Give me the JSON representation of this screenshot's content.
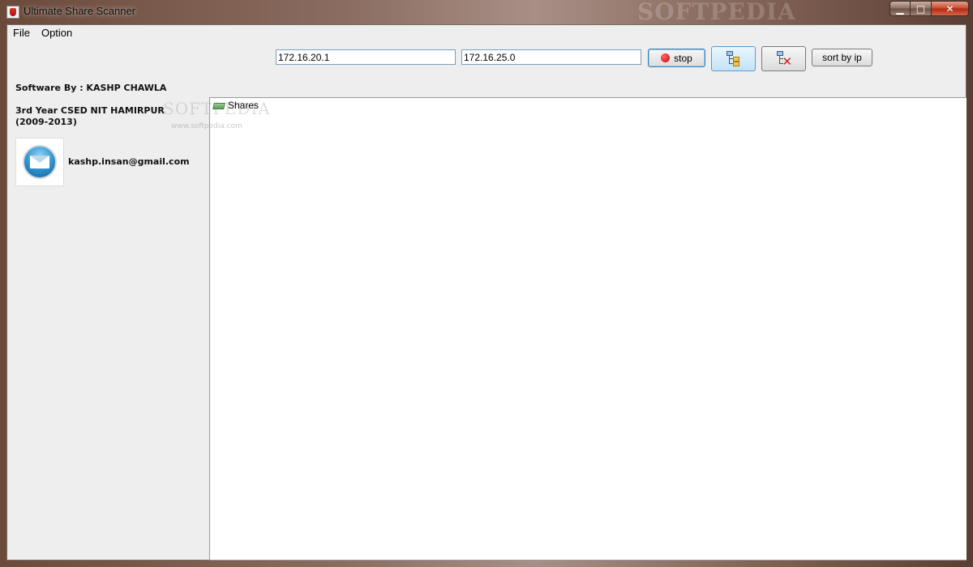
{
  "window": {
    "title": "Ultimate Share Scanner",
    "watermark": "SOFTPEDIA",
    "controls": {
      "minimize": "▁",
      "maximize": "□",
      "close": "✕"
    }
  },
  "menu": [
    {
      "label": "File"
    },
    {
      "label": "Option"
    }
  ],
  "sidebar": {
    "author": "Software By : KASHP CHAWLA",
    "institution_line1": "3rd Year CSED NIT HAMIRPUR",
    "institution_line2": "(2009-2013)",
    "email": "kashp.insan@gmail.com",
    "email_icon": "mail-icon"
  },
  "toolbar": {
    "start_ip": "172.16.20.1",
    "end_ip": "172.16.25.0",
    "stop_label": "stop",
    "sort_label": "sort by ip",
    "scan_tree_icon": "tree-icon",
    "clear_tree_icon": "tree-delete-icon"
  },
  "tree": {
    "root_label": "Shares",
    "root_icon": "folder-icon"
  },
  "watermark_overlay": {
    "text": "SOFTPEDIA",
    "url": "www.softpedia.com"
  },
  "colors": {
    "client_bg": "#eeeeee",
    "accent_blue": "#3c7fb1",
    "stop_red": "#cc0000"
  }
}
